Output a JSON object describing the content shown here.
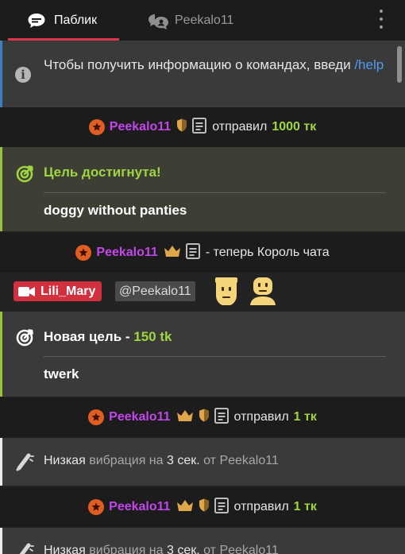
{
  "tabs": [
    {
      "label": "Паблик",
      "icon": "chat-bubble-icon",
      "active": true
    },
    {
      "label": "Peekalo11",
      "icon": "private-chat-icon",
      "active": false
    }
  ],
  "info": {
    "text": "Чтобы получить информацию о командах, введи ",
    "link": "/help"
  },
  "messages": {
    "tip1": {
      "user": "Peekalo11",
      "action": "отправил",
      "amount": "1000 тк"
    },
    "goal_reached": {
      "title": "Цель достигнута!",
      "desc": "doggy without panties"
    },
    "king": {
      "user": "Peekalo11",
      "text": "- теперь Король чата"
    },
    "chat": {
      "sender": "Lili_Mary",
      "mention": "@Peekalo11"
    },
    "new_goal": {
      "title": "Новая цель - ",
      "amount": "150 tk",
      "desc": "twerk"
    },
    "tip2": {
      "user": "Peekalo11",
      "action": "отправил",
      "amount": "1 тк"
    },
    "vib1": {
      "a": "Низкая",
      "b": " вибрация на ",
      "c": "3 сек.",
      "d": " от Peekalo11"
    },
    "tip3": {
      "user": "Peekalo11",
      "action": "отправил",
      "amount": "1 тк"
    },
    "vib2": {
      "a": "Низкая",
      "b": " вибрация на ",
      "c": "3 сек.",
      "d": " от Peekalo11"
    }
  },
  "colors": {
    "accent_red": "#d8344a",
    "username_purple": "#c246ea",
    "amount_green": "#9fd640",
    "link_blue": "#4e9cf0"
  }
}
